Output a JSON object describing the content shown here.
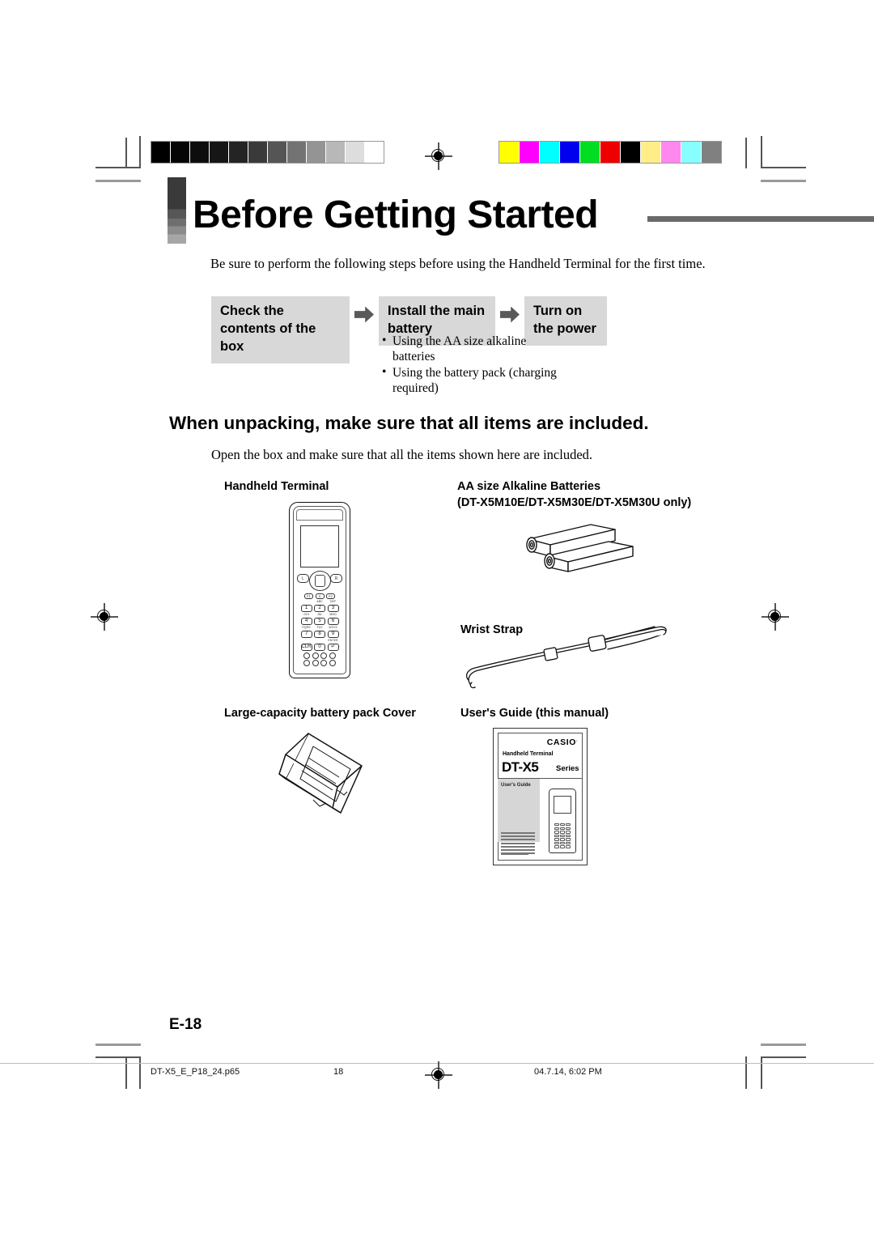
{
  "document": {
    "title": "Before Getting Started",
    "intro": "Be sure to perform the following steps before using the Handheld Terminal for the first time.",
    "section_heading": "When unpacking, make sure that all items are included.",
    "section_sub": "Open the box and make sure that all the items shown here are included.",
    "page_label": "E-18"
  },
  "steps": {
    "box1": "Check the contents of the box",
    "box2": "Install the main battery",
    "box3": "Turn on the power",
    "arrow1": "arrow-right",
    "arrow2": "arrow-right",
    "notes": [
      "Using the AA size alkaline batteries",
      "Using the battery pack (charging required)"
    ]
  },
  "items": [
    {
      "label": "Handheld Terminal",
      "sublabel": ""
    },
    {
      "label": "AA size Alkaline Batteries",
      "sublabel": "(DT-X5M10E/DT-X5M30E/DT-X5M30U only)"
    },
    {
      "label": "Wrist Strap",
      "sublabel": ""
    },
    {
      "label": "Large-capacity battery pack Cover",
      "sublabel": ""
    },
    {
      "label": "User's Guide (this manual)",
      "sublabel": ""
    }
  ],
  "terminal": {
    "keys_row_fn_top": [
      "F1",
      "0",
      "F2"
    ],
    "keys_rows": [
      [
        "1",
        "2",
        "3"
      ],
      [
        "4",
        "5",
        "6"
      ],
      [
        "7",
        "8",
        "9"
      ],
      [
        "CLR",
        "0",
        "↵"
      ]
    ],
    "key_captions": [
      [
        "",
        "ABC",
        "DEF"
      ],
      [
        "GHI",
        "JKL",
        "MNO"
      ],
      [
        "PQRS",
        "TUV",
        "WXYZ"
      ],
      [
        "",
        "",
        "ENTER"
      ]
    ]
  },
  "manual_cover": {
    "brand": "CASIO",
    "brand_mark": ".",
    "product_line": "Handheld Terminal",
    "model": "DT-X5",
    "series": "Series",
    "guide_label": "User's Guide"
  },
  "footer": {
    "filename": "DT-X5_E_P18_24.p65",
    "page": "18",
    "timestamp": "04.7.14, 6:02 PM"
  },
  "print_marks": {
    "grayscale_swatches": [
      "#000000",
      "#050505",
      "#0d0d0d",
      "#161616",
      "#242424",
      "#3a3a3a",
      "#555555",
      "#737373",
      "#949494",
      "#b8b8b8",
      "#dddddd",
      "#ffffff"
    ],
    "color_swatches": [
      "#ffff00",
      "#ff00ff",
      "#00ffff",
      "#0000ee",
      "#00dd22",
      "#ee0000",
      "#000000",
      "#ffee88",
      "#ff88ee",
      "#88ffff",
      "#808080"
    ]
  }
}
